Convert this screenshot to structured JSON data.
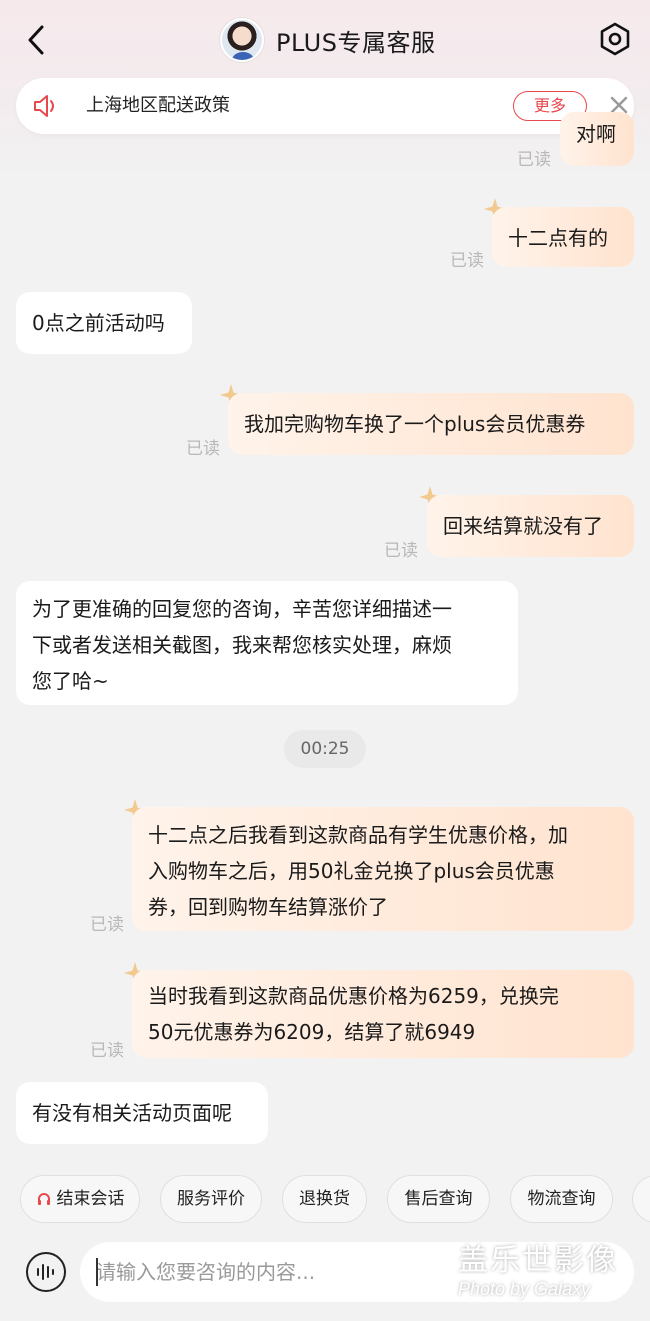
{
  "header": {
    "title": "PLUS专属客服",
    "back_icon": "chevron-left-icon",
    "settings_icon": "settings-hex-icon"
  },
  "notice": {
    "text": "上海地区配送政策",
    "more_label": "更多",
    "close_icon": "close-icon",
    "speaker_icon": "speaker-icon"
  },
  "messages": [
    {
      "from": "user",
      "text": "对啊",
      "read": "已读"
    },
    {
      "from": "user",
      "text": "十二点有的",
      "read": "已读"
    },
    {
      "from": "agent",
      "text": "0点之前活动吗"
    },
    {
      "from": "user",
      "text": "我加完购物车换了一个plus会员优惠券",
      "read": "已读"
    },
    {
      "from": "user",
      "text": "回来结算就没有了",
      "read": "已读"
    },
    {
      "from": "agent",
      "lines": [
        "为了更准确的回复您的咨询，辛苦您详细描述一",
        "下或者发送相关截图，我来帮您核实处理，麻烦",
        "您了哈~"
      ]
    },
    {
      "from": "system",
      "text": "00:25"
    },
    {
      "from": "user",
      "lines": [
        "十二点之后我看到这款商品有学生优惠价格，加",
        "入购物车之后，用50礼金兑换了plus会员优惠",
        "券，回到购物车结算涨价了"
      ],
      "read": "已读"
    },
    {
      "from": "user",
      "lines": [
        "当时我看到这款商品优惠价格为6259，兑换完",
        "50元优惠券为6209，结算了就6949"
      ],
      "read": "已读"
    },
    {
      "from": "agent",
      "text": "有没有相关活动页面呢"
    }
  ],
  "quick_actions": [
    "结束会话",
    "服务评价",
    "退换货",
    "售后查询",
    "物流查询"
  ],
  "input": {
    "placeholder": "请输入您要咨询的内容...",
    "voice_icon": "voice-wave-icon"
  },
  "watermark": {
    "line1": "盖乐世影像",
    "line2": "Photo by Galaxy"
  },
  "colors": {
    "accent_red": "#e8474c",
    "bubble_out_start": "#fff3ea",
    "bubble_out_end": "#ffe3cf",
    "background": "#f2f2f2"
  }
}
